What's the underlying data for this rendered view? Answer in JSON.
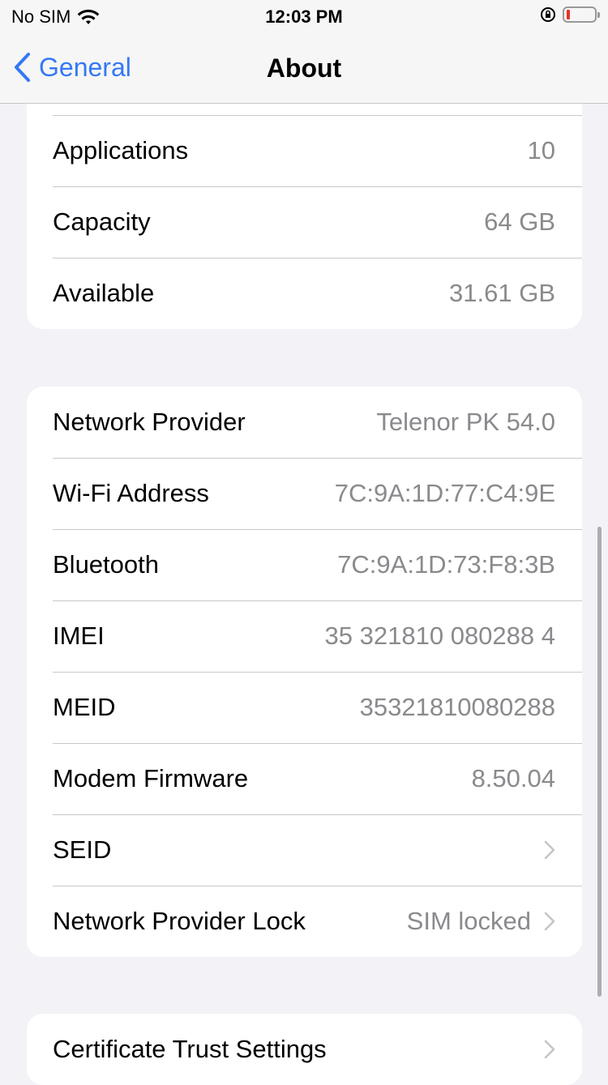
{
  "status_bar": {
    "carrier": "No SIM",
    "time": "12:03 PM",
    "icons": [
      "wifi-icon",
      "orientation-lock-icon",
      "battery-low-icon"
    ],
    "battery_color": "#e8332a"
  },
  "nav": {
    "back_label": "General",
    "title": "About",
    "accent": "#3478f6"
  },
  "storage": [
    {
      "label": "Applications",
      "value": "10"
    },
    {
      "label": "Capacity",
      "value": "64 GB"
    },
    {
      "label": "Available",
      "value": "31.61 GB"
    }
  ],
  "network": [
    {
      "label": "Network Provider",
      "value": "Telenor PK 54.0"
    },
    {
      "label": "Wi-Fi Address",
      "value": "7C:9A:1D:77:C4:9E"
    },
    {
      "label": "Bluetooth",
      "value": "7C:9A:1D:73:F8:3B"
    },
    {
      "label": "IMEI",
      "value": "35 321810 080288 4"
    },
    {
      "label": "MEID",
      "value": "35321810080288"
    },
    {
      "label": "Modem Firmware",
      "value": "8.50.04"
    },
    {
      "label": "SEID",
      "value": ""
    },
    {
      "label": "Network Provider Lock",
      "value": "SIM locked"
    }
  ],
  "certificate": {
    "label": "Certificate Trust Settings"
  }
}
